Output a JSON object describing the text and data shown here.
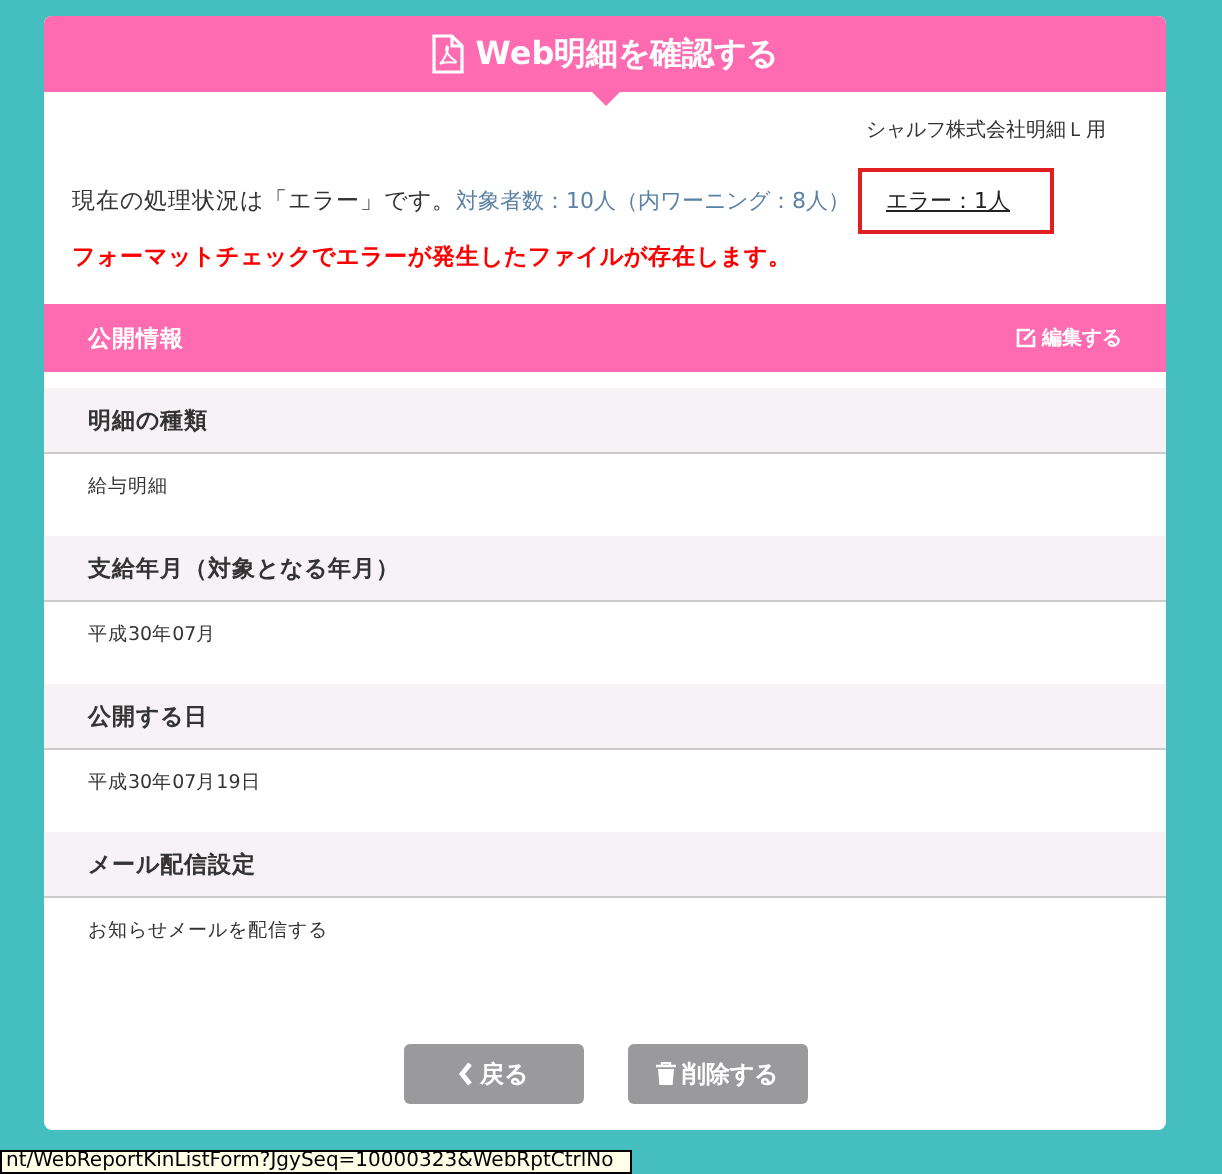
{
  "header": {
    "title": "Web明細を確認する"
  },
  "company": "シャルフ株式会社明細Ｌ用",
  "status": {
    "text": "現在の処理状況は「エラー」です。",
    "summary": "対象者数：10人（内ワーニング：8人）",
    "error_link": {
      "label": "エラー：1人",
      "highlighted": true
    }
  },
  "error_message": "フォーマットチェックでエラーが発生したファイルが存在します。",
  "section": {
    "title": "公開情報",
    "edit_label": "編集する"
  },
  "fields": [
    {
      "label": "明細の種類",
      "value": "給与明細"
    },
    {
      "label": "支給年月（対象となる年月）",
      "value": "平成30年07月"
    },
    {
      "label": "公開する日",
      "value": "平成30年07月19日"
    },
    {
      "label": "メール配信設定",
      "value": "お知らせメールを配信する"
    }
  ],
  "buttons": [
    {
      "kind": "back",
      "label": "戻る"
    },
    {
      "kind": "delete",
      "label": "削除する"
    }
  ],
  "status_bar": "nt/WebReportKinListForm?JgySeq=10000323&WebRptCtrlNo"
}
